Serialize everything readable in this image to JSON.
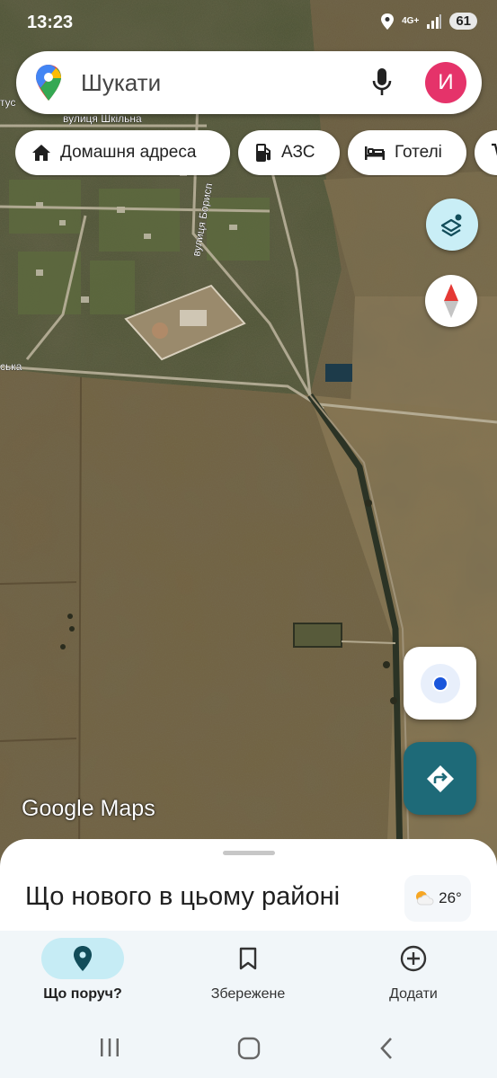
{
  "status_bar": {
    "time": "13:23",
    "network": "4G+",
    "battery": "61"
  },
  "search": {
    "placeholder": "Шукати",
    "avatar_letter": "И"
  },
  "chips": [
    {
      "label": "Домашня адреса",
      "icon": "home-icon"
    },
    {
      "label": "АЗС",
      "icon": "gas-station-icon"
    },
    {
      "label": "Готелі",
      "icon": "bed-icon"
    },
    {
      "label": "",
      "icon": "shopping-cart-icon"
    }
  ],
  "map": {
    "watermark": "Google Maps",
    "street_labels": [
      "вулиця Шкільна",
      "вулиця Борисп",
      "ська",
      "тус"
    ]
  },
  "sheet": {
    "title": "Що нового в цьому районі",
    "temperature": "26°",
    "weather_icon": "partly-cloudy-icon"
  },
  "bottom_nav": [
    {
      "label": "Що поруч?",
      "icon": "location-pin-icon",
      "active": true
    },
    {
      "label": "Збережене",
      "icon": "bookmark-icon",
      "active": false
    },
    {
      "label": "Додати",
      "icon": "add-circle-icon",
      "active": false
    }
  ],
  "colors": {
    "avatar": "#e5336a",
    "directions": "#1e6a78",
    "active_tab": "#c6ecf5",
    "location_dot": "#1a56db"
  }
}
